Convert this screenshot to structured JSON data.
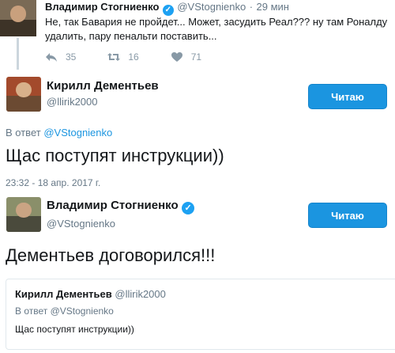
{
  "colors": {
    "accent": "#1b95e0",
    "muted": "#657786",
    "border": "#e1e8ed"
  },
  "parent_tweet": {
    "name": "Владимир Стогниенко",
    "handle": "@VStognienko",
    "separator": "·",
    "time": "29 мин",
    "text_line1": "Не, так Бавария не пройдет... Может, засудить Реал??? ну там Роналду",
    "text_line2": "удалить, пару пенальти поставить...",
    "actions": {
      "reply_count": "35",
      "retweet_count": "16",
      "like_count": "71"
    }
  },
  "reply_tweet": {
    "name": "Кирилл Дементьев",
    "handle": "@llirik2000",
    "follow_label": "Читаю",
    "reply_prefix": "В ответ",
    "reply_handle": "@VStognienko",
    "text": "Щас поступят инструкции))",
    "timestamp": "23:32 - 18 апр. 2017 г."
  },
  "main_tweet": {
    "name": "Владимир Стогниенко",
    "handle": "@VStognienko",
    "follow_label": "Читаю",
    "text": "Дементьев договорился!!!"
  },
  "quoted_tweet": {
    "name": "Кирилл Дементьев",
    "handle": "@llirik2000",
    "reply_prefix": "В ответ",
    "reply_handle": "@VStognienko",
    "text": "Щас поступят инструкции))"
  }
}
